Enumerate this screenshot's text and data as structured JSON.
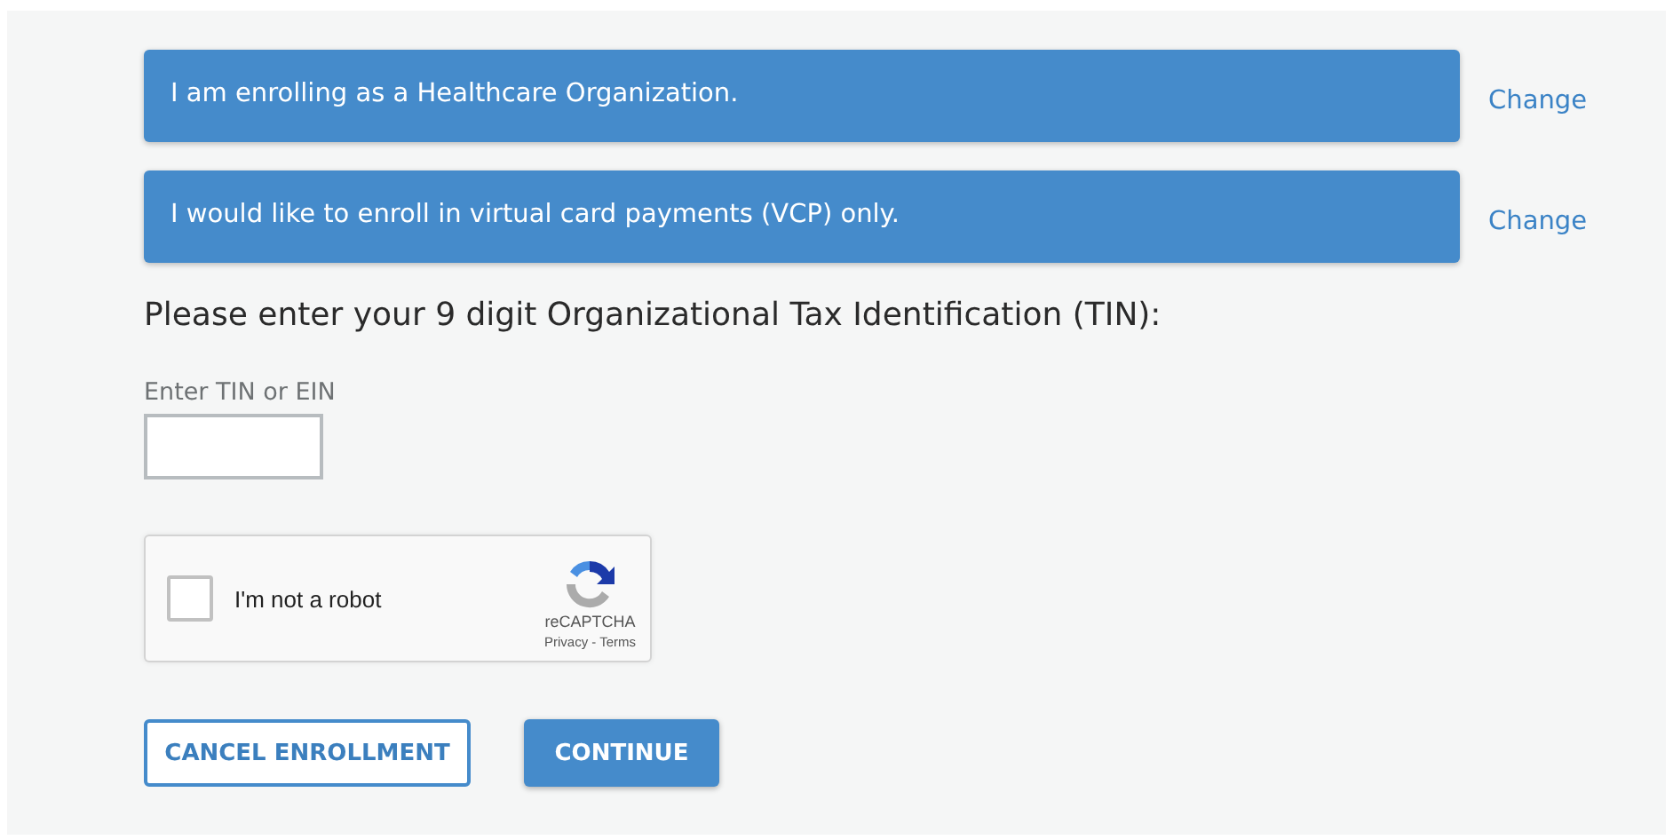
{
  "choices": [
    {
      "text": "I am enrolling as a Healthcare Organization.",
      "link": "Change"
    },
    {
      "text": "I would like to enroll in virtual card payments (VCP) only.",
      "link": "Change"
    }
  ],
  "prompt": "Please enter your 9 digit Organizational Tax Identification (TIN):",
  "tin_field": {
    "label": "Enter TIN or EIN"
  },
  "captcha": {
    "label": "I'm not a robot",
    "checked": false,
    "brand": "reCAPTCHA",
    "links": [
      "Privacy",
      "Terms"
    ],
    "separator": "-"
  },
  "buttons": [
    {
      "label": "CANCEL ENROLLMENT",
      "kind": "outline"
    },
    {
      "label": "CONTINUE",
      "kind": "primary"
    }
  ]
}
